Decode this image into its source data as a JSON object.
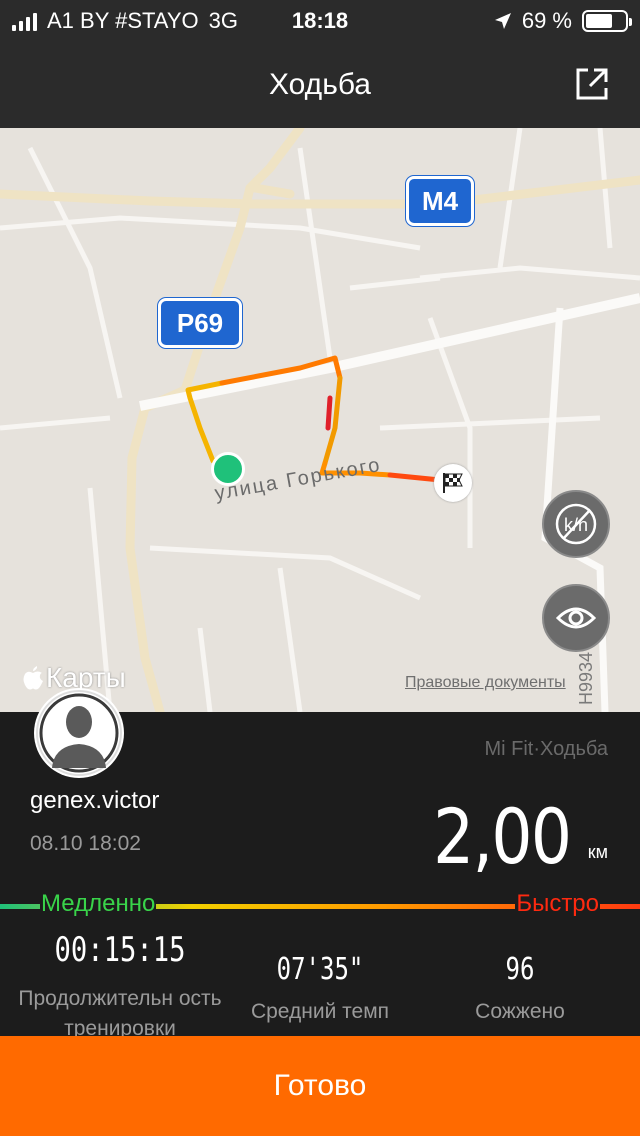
{
  "status_bar": {
    "carrier": "A1 BY #STAYO",
    "network": "3G",
    "time": "18:18",
    "battery": "69 %",
    "battery_level": 0.69
  },
  "nav": {
    "title": "Ходьба",
    "share_icon": "share-icon"
  },
  "map": {
    "shield_m4": "M4",
    "shield_p69": "P69",
    "street": "улица Горького",
    "brand": "Карты",
    "legal": "Правовые документы",
    "road_code": "H9934",
    "route_colors": [
      "#f5b400",
      "#ff7a00",
      "#ff4a10"
    ],
    "start_color": "#1fc17a"
  },
  "workout": {
    "username": "genex.victor",
    "datetime": "08.10 18:02",
    "source": "Mi Fit·Ходьба",
    "distance": "2,00",
    "distance_unit": "км",
    "pace_slow": "Медленно",
    "pace_fast": "Быстро",
    "stats": [
      {
        "value": "00:15:15",
        "label": "Продолжительн ость тренировки"
      },
      {
        "value": "07'35\"",
        "label": "Средний темп"
      },
      {
        "value": "96",
        "label": "Сожжено"
      }
    ]
  },
  "actions": {
    "done": "Готово"
  }
}
